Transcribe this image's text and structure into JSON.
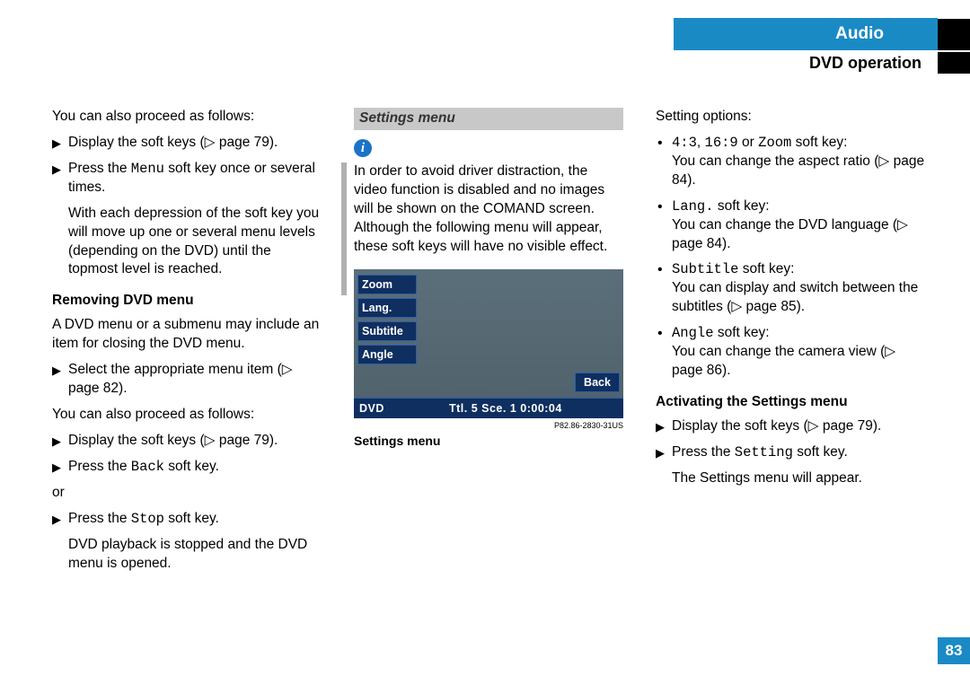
{
  "header": {
    "chapter": "Audio",
    "section": "DVD operation"
  },
  "page_number": "83",
  "col1": {
    "intro": "You can also proceed as follows:",
    "step1": "Display the soft keys (▷ page 79).",
    "step2_pre": "Press the ",
    "step2_mono": "Menu",
    "step2_post": " soft key once or several times.",
    "step2_follow": "With each depression of the soft key you will move up one or several menu levels (depending on the DVD) until the topmost level is reached.",
    "h_removing": "Removing DVD menu",
    "removing_p": "A DVD menu or a submenu may include an item for closing the DVD menu.",
    "rem_step1": "Select the appropriate menu item (▷ page 82).",
    "rem_intro2": "You can also proceed as follows:",
    "rem_step2": "Display the soft keys (▷ page 79).",
    "rem_step3_pre": "Press the ",
    "rem_step3_mono": "Back",
    "rem_step3_post": " soft key.",
    "or": "or",
    "rem_step4_pre": "Press the ",
    "rem_step4_mono": "Stop",
    "rem_step4_post": " soft key.",
    "rem_step4_follow": "DVD playback is stopped and the DVD menu is opened."
  },
  "col2": {
    "h_settings": "Settings menu",
    "info_text": "In order to avoid driver distraction, the video function is disabled and no images will be shown on the COMAND screen. Although the following menu will appear, these soft keys will have no visible effect.",
    "sk_zoom": "Zoom",
    "sk_lang": "Lang.",
    "sk_subtitle": "Subtitle",
    "sk_angle": "Angle",
    "sk_back": "Back",
    "status_dvd": "DVD",
    "status_tt": "Ttl. 5 Sce. 1  0:00:04",
    "shot_id": "P82.86-2830-31US",
    "shot_caption": "Settings menu"
  },
  "col3": {
    "opt_h": "Setting options:",
    "b1_mono_a": "4:3",
    "b1_sep1": ", ",
    "b1_mono_b": "16:9",
    "b1_sep2": " or ",
    "b1_mono_c": "Zoom",
    "b1_post": " soft key:",
    "b1_sub": "You can change the aspect ratio (▷ page 84).",
    "b2_mono": "Lang.",
    "b2_post": " soft key:",
    "b2_sub": "You can change the DVD language (▷ page 84).",
    "b3_mono": "Subtitle",
    "b3_post": " soft key:",
    "b3_sub": "You can display and switch between the subtitles (▷ page 85).",
    "b4_mono": "Angle",
    "b4_post": " soft key:",
    "b4_sub": "You can change the camera view (▷ page 86).",
    "h_activate": "Activating the Settings menu",
    "act_step1": "Display the soft keys (▷ page 79).",
    "act_step2_pre": "Press the ",
    "act_step2_mono": "Setting",
    "act_step2_post": " soft key.",
    "act_follow": "The Settings menu will appear."
  }
}
